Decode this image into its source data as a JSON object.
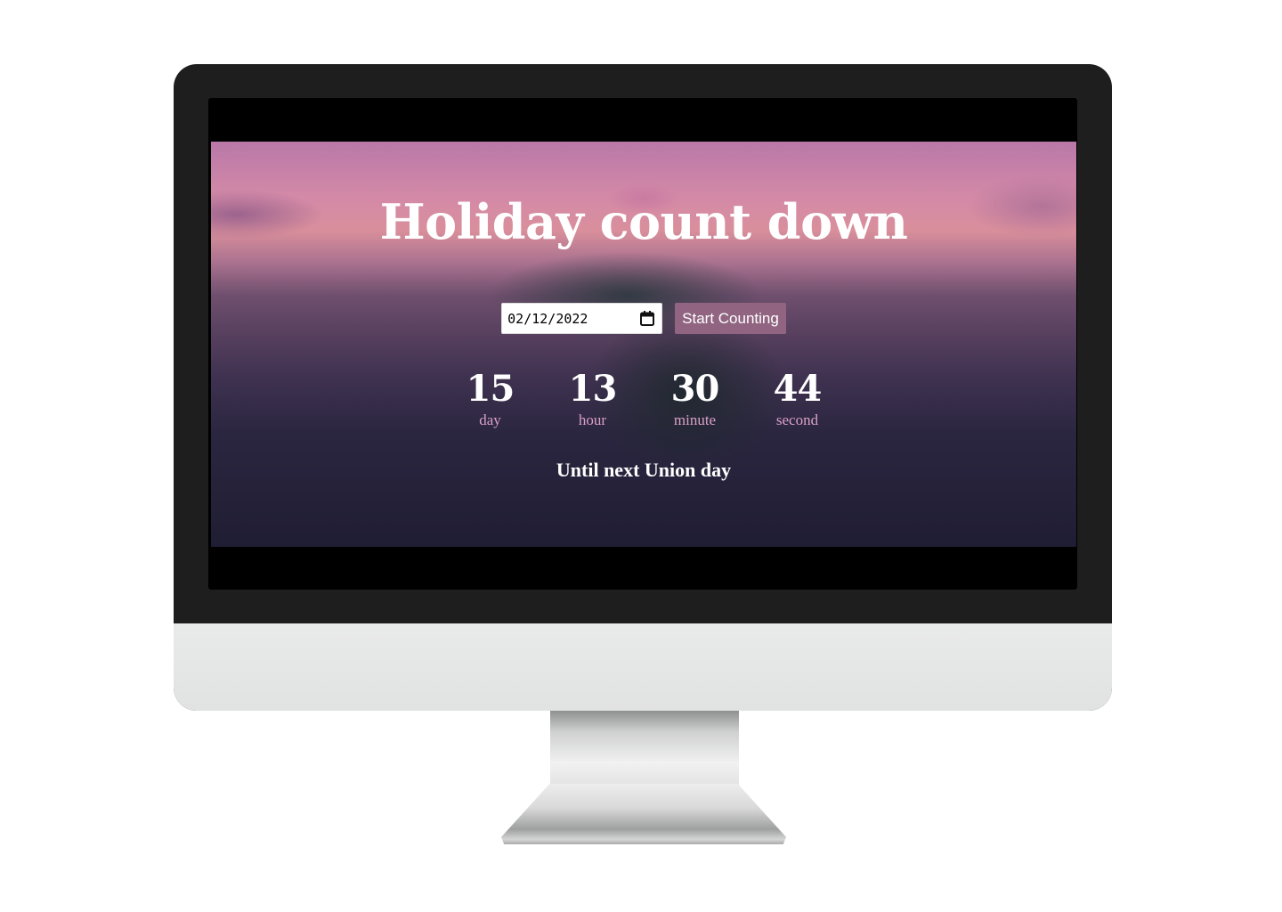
{
  "app": {
    "title": "Holiday count down"
  },
  "controls": {
    "date_value": "02/12/2022",
    "start_button_label": "Start Counting"
  },
  "countdown": [
    {
      "value": "15",
      "label": "day"
    },
    {
      "value": "13",
      "label": "hour"
    },
    {
      "value": "30",
      "label": "minute"
    },
    {
      "value": "44",
      "label": "second"
    }
  ],
  "footer": {
    "until_text": "Until next Union day"
  },
  "icons": {
    "date_picker": "calendar-icon"
  },
  "colors": {
    "button_bg": "#916582",
    "unit_label": "#d9a0c8",
    "title_text": "#ffffff"
  }
}
